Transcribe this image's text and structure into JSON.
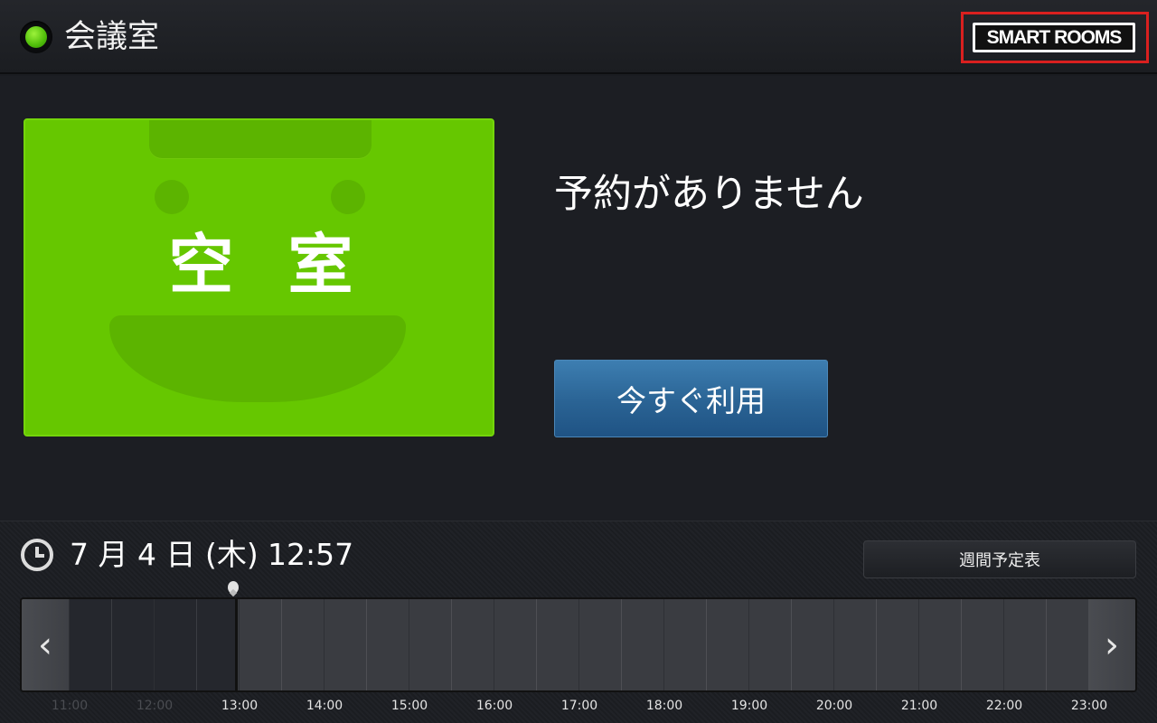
{
  "header": {
    "room_name": "会議室",
    "logo_text": "SMART ROOMS",
    "status_color": "#4fbd0a"
  },
  "status_card": {
    "label": "空室",
    "color": "#66c700"
  },
  "reservation": {
    "message": "予約がありません",
    "use_now_label": "今すぐ利用"
  },
  "footer": {
    "date": "7 月 4 日 (木)",
    "time": "12:57",
    "weekly_button_label": "週間予定表",
    "prev_icon": "chevron-left-icon",
    "next_icon": "chevron-right-icon",
    "timeline": {
      "ticks": [
        "11:00",
        "12:00",
        "13:00",
        "14:00",
        "15:00",
        "16:00",
        "17:00",
        "18:00",
        "19:00",
        "20:00",
        "21:00",
        "22:00",
        "23:00"
      ],
      "past_ticks": [
        "11:00",
        "12:00"
      ]
    }
  }
}
